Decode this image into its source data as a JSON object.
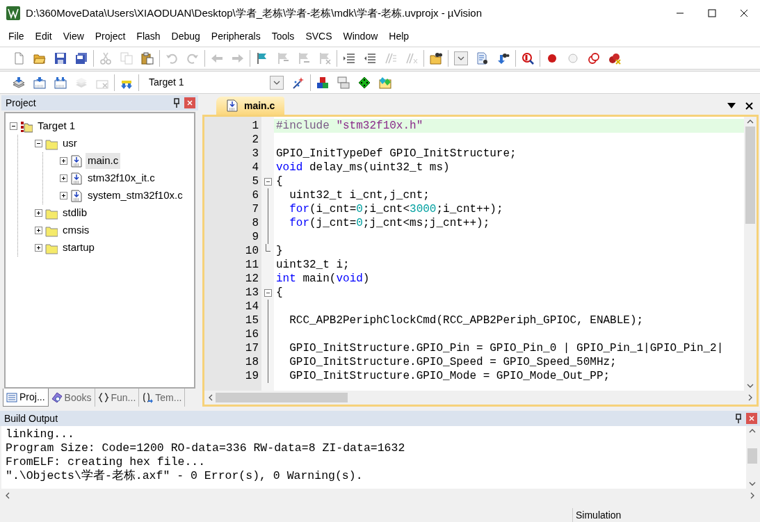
{
  "window": {
    "title": "D:\\360MoveData\\Users\\XIAODUAN\\Desktop\\学者_老栋\\学者-老栋\\mdk\\学者-老栋.uvprojx - µVision"
  },
  "menu": [
    "File",
    "Edit",
    "View",
    "Project",
    "Flash",
    "Debug",
    "Peripherals",
    "Tools",
    "SVCS",
    "Window",
    "Help"
  ],
  "toolbar_1": [
    [
      {
        "kind": "new",
        "disabled": false
      },
      {
        "kind": "open",
        "disabled": false
      },
      {
        "kind": "save",
        "disabled": false
      },
      {
        "kind": "saveall",
        "disabled": false
      }
    ],
    [
      {
        "kind": "cut",
        "disabled": true
      },
      {
        "kind": "copy",
        "disabled": true
      },
      {
        "kind": "paste",
        "disabled": false
      }
    ],
    [
      {
        "kind": "undo",
        "disabled": true
      },
      {
        "kind": "redo",
        "disabled": true
      }
    ],
    [
      {
        "kind": "back",
        "disabled": true
      },
      {
        "kind": "forward",
        "disabled": true
      }
    ],
    [
      {
        "kind": "flag",
        "disabled": false
      },
      {
        "kind": "flagprev",
        "disabled": true
      },
      {
        "kind": "flagnext",
        "disabled": true
      },
      {
        "kind": "flagclear",
        "disabled": true
      }
    ],
    [
      {
        "kind": "indent",
        "disabled": false
      },
      {
        "kind": "outdent",
        "disabled": false
      },
      {
        "kind": "comment",
        "disabled": true
      },
      {
        "kind": "uncomment",
        "disabled": true
      }
    ],
    [
      {
        "kind": "findfiles",
        "disabled": false
      }
    ],
    [
      {
        "kind": "combo",
        "disabled": false
      },
      {
        "kind": "find",
        "disabled": false
      },
      {
        "kind": "incfind",
        "disabled": false
      }
    ],
    [
      {
        "kind": "debug",
        "disabled": false
      }
    ],
    [
      {
        "kind": "bp",
        "disabled": false
      },
      {
        "kind": "bpoff",
        "disabled": false
      },
      {
        "kind": "bps",
        "disabled": false
      },
      {
        "kind": "bpkill",
        "disabled": false
      }
    ]
  ],
  "toolbar_2": [
    [
      {
        "kind": "translate",
        "disabled": false
      },
      {
        "kind": "build",
        "disabled": false
      },
      {
        "kind": "rebuild",
        "disabled": false
      },
      {
        "kind": "batch",
        "disabled": true
      },
      {
        "kind": "stop",
        "disabled": true
      }
    ],
    [
      {
        "kind": "load",
        "disabled": false
      }
    ],
    [
      {
        "kind": "select",
        "disabled": false,
        "value": "Target 1"
      },
      {
        "kind": "wand",
        "disabled": false
      }
    ],
    [
      {
        "kind": "components",
        "disabled": false
      },
      {
        "kind": "windows",
        "disabled": false
      },
      {
        "kind": "diamond",
        "disabled": false
      },
      {
        "kind": "pack",
        "disabled": false
      }
    ]
  ],
  "project_panel": {
    "title": "Project",
    "tree": [
      {
        "label": "Target 1",
        "kind": "target",
        "expanded": true,
        "selected": false,
        "children": [
          {
            "label": "usr",
            "kind": "folder",
            "expanded": true,
            "selected": false,
            "children": [
              {
                "label": "main.c",
                "kind": "file",
                "expanded": false,
                "selected": true
              },
              {
                "label": "stm32f10x_it.c",
                "kind": "file",
                "expanded": false,
                "selected": false
              },
              {
                "label": "system_stm32f10x.c",
                "kind": "file",
                "expanded": false,
                "selected": false
              }
            ]
          },
          {
            "label": "stdlib",
            "kind": "folder",
            "expanded": false,
            "selected": false
          },
          {
            "label": "cmsis",
            "kind": "folder",
            "expanded": false,
            "selected": false
          },
          {
            "label": "startup",
            "kind": "folder",
            "expanded": false,
            "selected": false
          }
        ]
      }
    ],
    "tabs": [
      {
        "label": "Proj...",
        "kind": "project",
        "selected": true
      },
      {
        "label": "Books",
        "kind": "books",
        "selected": false
      },
      {
        "label": "Fun...",
        "kind": "functions",
        "selected": false
      },
      {
        "label": "Tem...",
        "kind": "templates",
        "selected": false
      }
    ]
  },
  "editor": {
    "tabs": [
      {
        "label": "main.c",
        "selected": true
      }
    ],
    "lines": [
      {
        "number": "1",
        "current": true,
        "tokens": [
          {
            "kind": "preproc",
            "text": "#include"
          },
          {
            "kind": "string",
            "text": " \"stm32f10x.h\""
          }
        ]
      },
      {
        "number": "2"
      },
      {
        "number": "3",
        "tokens": [
          {
            "kind": "plain",
            "text": "GPIO_InitTypeDef GPIO_InitStructure;"
          }
        ]
      },
      {
        "number": "4",
        "tokens": [
          {
            "kind": "keyword",
            "text": "void"
          },
          {
            "kind": "plain",
            "text": " delay_ms(uint32_t ms)"
          }
        ]
      },
      {
        "number": "5",
        "collapsible": true,
        "tokens": [
          {
            "kind": "plain",
            "text": "{"
          }
        ]
      },
      {
        "number": "6",
        "indented": true,
        "tokens": [
          {
            "kind": "plain",
            "text": "uint32_t i_cnt,j_cnt;"
          }
        ]
      },
      {
        "number": "7",
        "indented": true,
        "tokens": [
          {
            "kind": "keyword",
            "text": "for"
          },
          {
            "kind": "plain",
            "text": "(i_cnt="
          },
          {
            "kind": "number",
            "text": "0"
          },
          {
            "kind": "plain",
            "text": ";i_cnt<"
          },
          {
            "kind": "number",
            "text": "3000"
          },
          {
            "kind": "plain",
            "text": ";i_cnt++);"
          }
        ]
      },
      {
        "number": "8",
        "indented": true,
        "tokens": [
          {
            "kind": "keyword",
            "text": "for"
          },
          {
            "kind": "plain",
            "text": "(j_cnt="
          },
          {
            "kind": "number",
            "text": "0"
          },
          {
            "kind": "plain",
            "text": ";j_cnt<ms;j_cnt++);"
          }
        ]
      },
      {
        "number": "9"
      },
      {
        "number": "10",
        "block_end": true,
        "tokens": [
          {
            "kind": "plain",
            "text": "}"
          }
        ]
      },
      {
        "number": "11",
        "tokens": [
          {
            "kind": "plain",
            "text": "uint32_t i;"
          }
        ]
      },
      {
        "number": "12",
        "tokens": [
          {
            "kind": "keyword",
            "text": "int"
          },
          {
            "kind": "plain",
            "text": " main("
          },
          {
            "kind": "keyword",
            "text": "void"
          },
          {
            "kind": "plain",
            "text": ")"
          }
        ]
      },
      {
        "number": "13",
        "collapsible": true,
        "tokens": [
          {
            "kind": "plain",
            "text": "{"
          }
        ]
      },
      {
        "number": "14"
      },
      {
        "number": "15",
        "indented": true,
        "tokens": [
          {
            "kind": "plain",
            "text": "RCC_APB2PeriphClockCmd(RCC_APB2Periph_GPIOC, ENABLE);"
          }
        ]
      },
      {
        "number": "16"
      },
      {
        "number": "17",
        "indented": true,
        "tokens": [
          {
            "kind": "plain",
            "text": "GPIO_InitStructure.GPIO_Pin = GPIO_Pin_0 | GPIO_Pin_1|GPIO_Pin_2|"
          }
        ]
      },
      {
        "number": "18",
        "indented": true,
        "tokens": [
          {
            "kind": "plain",
            "text": "GPIO_InitStructure.GPIO_Speed = GPIO_Speed_50MHz;"
          }
        ]
      },
      {
        "number": "19",
        "indented": true,
        "tokens": [
          {
            "kind": "plain",
            "text": "GPIO_InitStructure.GPIO_Mode = GPIO_Mode_Out_PP;"
          }
        ]
      }
    ]
  },
  "build_output": {
    "title": "Build Output",
    "lines": [
      "linking...",
      "Program Size: Code=1200 RO-data=336 RW-data=8 ZI-data=1632",
      "FromELF: creating hex file...",
      "\".\\Objects\\学者-老栋.axf\" - 0 Error(s), 0 Warning(s)."
    ]
  },
  "status_bar": {
    "panels": [
      "Simulation"
    ]
  }
}
